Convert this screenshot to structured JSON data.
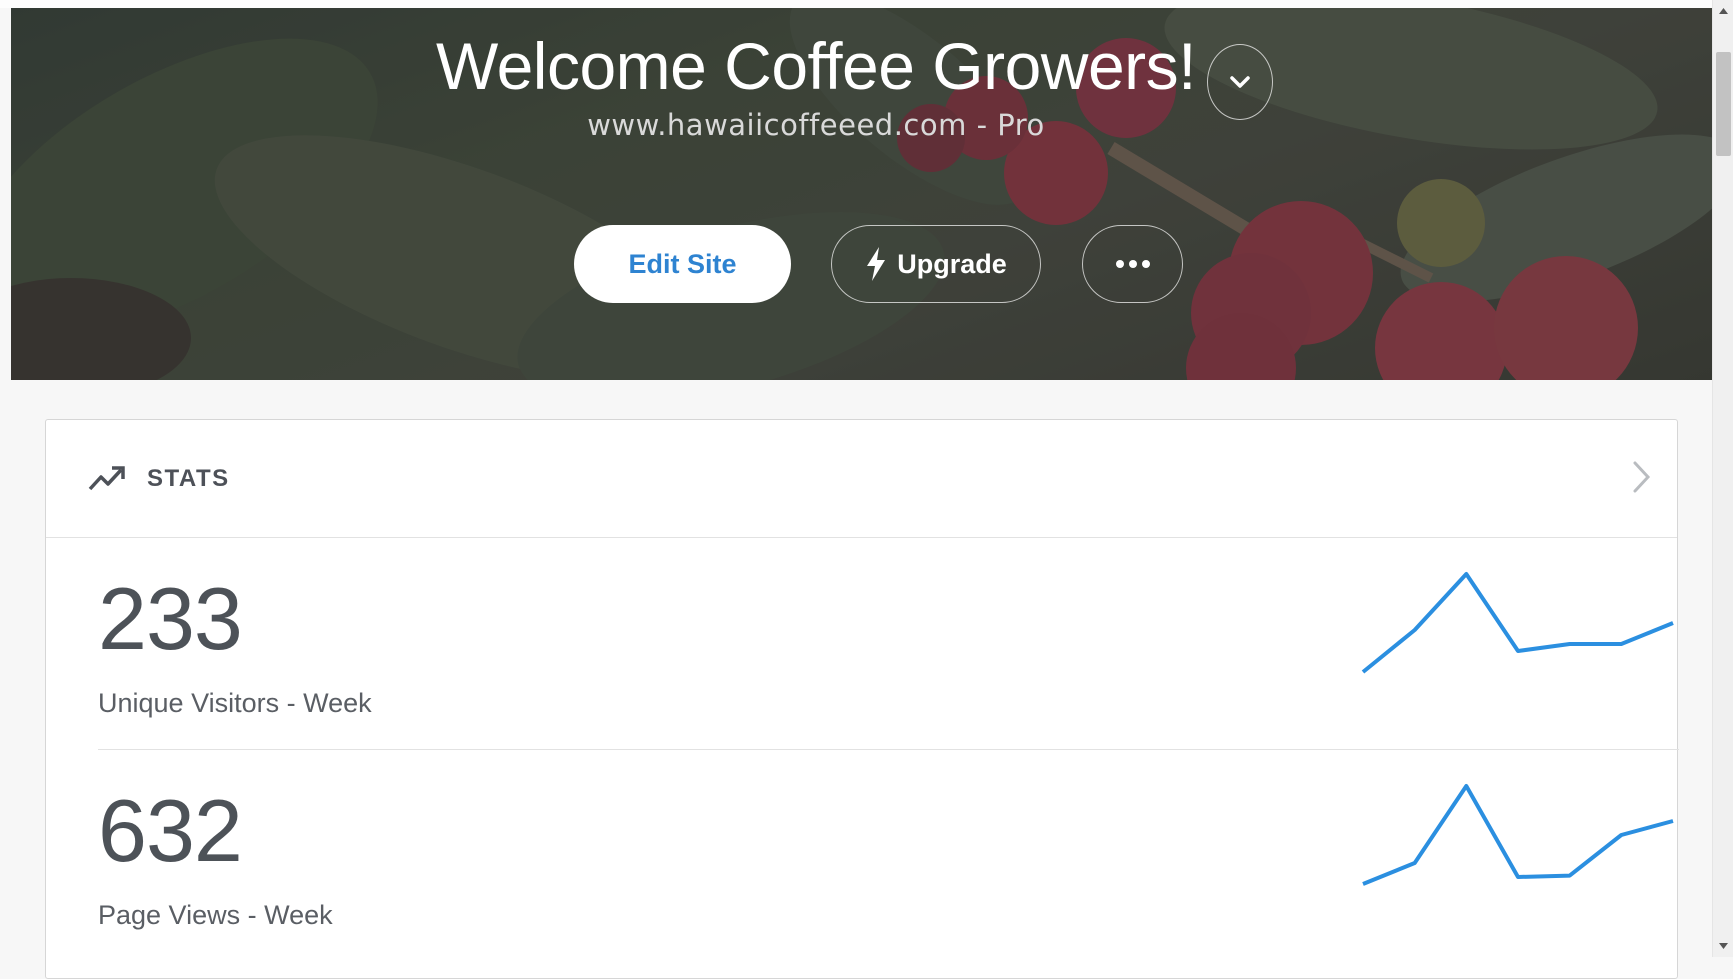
{
  "hero": {
    "title": "Welcome Coffee Growers!",
    "subtitle": "www.hawaiicoffeeed.com - Pro",
    "site_menu_icon": "chevron-down-icon",
    "edit_label": "Edit Site",
    "upgrade_label": "Upgrade",
    "upgrade_icon": "lightning-bolt-icon",
    "more_icon": "ellipsis-icon"
  },
  "stats": {
    "title": "STATS",
    "icon": "trending-up-icon",
    "items": [
      {
        "value": "233",
        "label": "Unique Visitors - Week",
        "trend": [
          1,
          4,
          8,
          2.5,
          3,
          3,
          4.5
        ]
      },
      {
        "value": "632",
        "label": "Page Views - Week",
        "trend": [
          1,
          2.5,
          8,
          1.5,
          1.6,
          4.5,
          5.5
        ]
      }
    ]
  },
  "colors": {
    "accent": "#2e83d1",
    "sparkline": "#2b8fe0",
    "text": "#4d5258"
  }
}
